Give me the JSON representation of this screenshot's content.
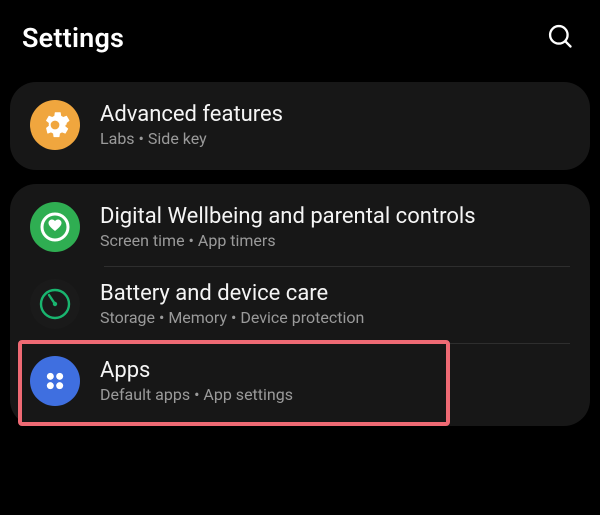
{
  "header": {
    "title": "Settings"
  },
  "groups": [
    {
      "items": [
        {
          "id": "advanced-features",
          "title": "Advanced features",
          "subtitle": "Labs  •  Side key",
          "icon": "gear",
          "iconBg": "#f0a63e",
          "iconFg": "#ffffff",
          "highlighted": false
        }
      ]
    },
    {
      "items": [
        {
          "id": "digital-wellbeing",
          "title": "Digital Wellbeing and parental controls",
          "subtitle": "Screen time  •  App timers",
          "icon": "wellbeing",
          "iconBg": "#2fae52",
          "iconFg": "#ffffff",
          "highlighted": false
        },
        {
          "id": "battery-device-care",
          "title": "Battery and device care",
          "subtitle": "Storage  •  Memory  •  Device protection",
          "icon": "care",
          "iconBg": "#1a1a1a",
          "iconFg": "#19b56f",
          "highlighted": false
        },
        {
          "id": "apps",
          "title": "Apps",
          "subtitle": "Default apps  •  App settings",
          "icon": "grid4",
          "iconBg": "#3f6fe0",
          "iconFg": "#ffffff",
          "highlighted": true
        }
      ]
    }
  ]
}
